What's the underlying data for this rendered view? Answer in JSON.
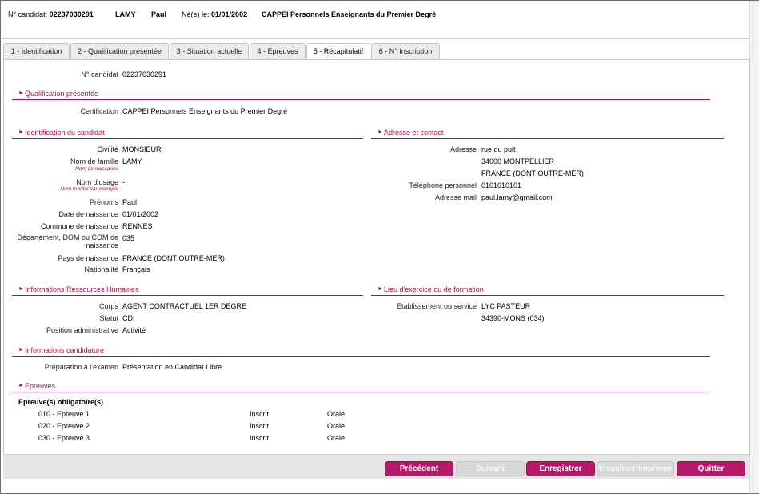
{
  "header": {
    "candidate_no_label": "N° candidat:",
    "candidate_no": "02237030291",
    "last_name": "LAMY",
    "first_name": "Paul",
    "birth_label": "Né(e) le:",
    "birth_date": "01/01/2002",
    "qualification": "CAPPEI Personnels Enseignants du Premier Degré"
  },
  "tabs": [
    {
      "label": "1 - Identification"
    },
    {
      "label": "2 - Qualification présentée"
    },
    {
      "label": "3 - Situation actuelle"
    },
    {
      "label": "4 - Epreuves"
    },
    {
      "label": "5 - Récapitulatif"
    },
    {
      "label": "6 - N° Inscription"
    }
  ],
  "summary": {
    "candidate_no_label": "N° candidat",
    "candidate_no": "02237030291"
  },
  "qualification": {
    "title": "Qualification présentée",
    "certification_label": "Certification",
    "certification": "CAPPEI Personnels Enseignants du Premier Degré"
  },
  "identification": {
    "title": "Identification du candidat",
    "civilite_label": "Civilité",
    "civilite": "MONSIEUR",
    "nom_famille_label": "Nom de famille",
    "nom_famille_hint": "Nom de naissance",
    "nom_famille": "LAMY",
    "nom_usage_label": "Nom d'usage",
    "nom_usage_hint": "Nom marital par exemple",
    "nom_usage": "-",
    "prenoms_label": "Prénoms",
    "prenoms": "Paul",
    "date_naissance_label": "Date de naissance",
    "date_naissance": "01/01/2002",
    "commune_label": "Commune de naissance",
    "commune": "RENNES",
    "departement_label": "Département, DOM ou COM de naissance",
    "departement": "035",
    "pays_label": "Pays de naissance",
    "pays": "FRANCE (DONT OUTRE-MER)",
    "nationalite_label": "Nationalité",
    "nationalite": "Français"
  },
  "contact": {
    "title": "Adresse et contact",
    "adresse_label": "Adresse",
    "adresse_line1": "rue du puit",
    "adresse_line2": "34000 MONTPELLIER",
    "adresse_line3": "FRANCE (DONT OUTRE-MER)",
    "telephone_label": "Téléphone personnel",
    "telephone": "0101010101",
    "email_label": "Adresse mail",
    "email": "paul.lamy@gmail.com"
  },
  "rh": {
    "title": "Informations Ressources Humaines",
    "corps_label": "Corps",
    "corps": "AGENT CONTRACTUEL 1ER DEGRE",
    "statut_label": "Statut",
    "statut": "CDI",
    "position_label": "Position administrative",
    "position": "Activité"
  },
  "lieu": {
    "title": "Lieu d'exercice ou de formation",
    "etab_label": "Etablissement ou service",
    "etab_line1": "LYC PASTEUR",
    "etab_line2": "34390-MONS (034)"
  },
  "candidature": {
    "title": "Informations candidature",
    "preparation_label": "Préparation à l'examen",
    "preparation": "Présentation en Candidat Libre"
  },
  "epreuves": {
    "title": "Epreuves",
    "group_title": "Epreuve(s) obligatoire(s)",
    "rows": [
      {
        "name": "010 - Epreuve 1",
        "status": "Inscrit",
        "mode": "Orale"
      },
      {
        "name": "020 - Epreuve 2",
        "status": "Inscrit",
        "mode": "Orale"
      },
      {
        "name": "030 - Epreuve 3",
        "status": "Inscrit",
        "mode": "Orale"
      }
    ]
  },
  "buttons": {
    "precedent": "Précédent",
    "suivant": "Suivant",
    "enregistrer": "Enregistrer",
    "visualiser": "Visualiser/imprimer",
    "quitter": "Quitter"
  },
  "colors": {
    "accent": "#a0134f",
    "button": "#b5196a",
    "disabled": "#d7d7d7"
  }
}
